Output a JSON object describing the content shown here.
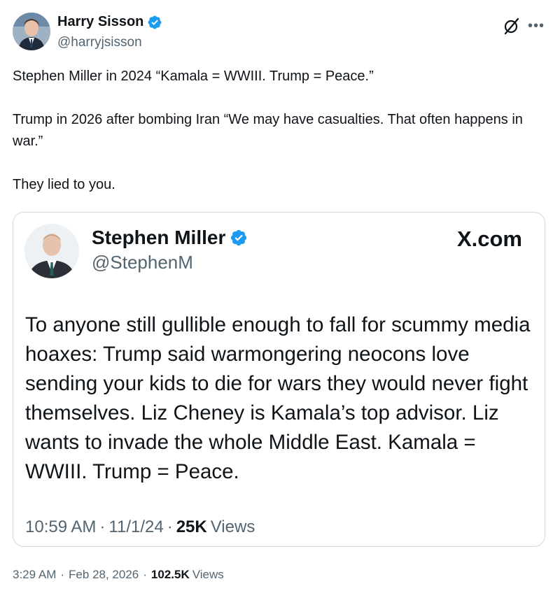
{
  "author": {
    "name": "Harry Sisson",
    "handle": "@harryjsisson",
    "verified_color": "#1d9bf0"
  },
  "tweet": {
    "lines": [
      "Stephen Miller in 2024 “Kamala = WWIII. Trump = Peace.”",
      "Trump in 2026 after bombing Iran “We may have casualties. That often happens in war.”",
      "They lied to you."
    ],
    "time": "3:29 AM",
    "date": "Feb 28, 2026",
    "views_count": "102.5K",
    "views_label": "Views"
  },
  "quoted": {
    "name": "Stephen Miller",
    "handle": "@StephenM",
    "site": "X.com",
    "text": "To anyone still gullible enough to fall for scummy media hoaxes: Trump said warmongering neocons love sending your kids to die for wars they would never fight themselves. Liz Cheney is Kamala’s top advisor. Liz wants to invade the whole Middle East. Kamala = WWIII. Trump = Peace.",
    "time": "10:59 AM",
    "date": "11/1/24",
    "views_count": "25K",
    "views_label": "Views"
  },
  "icons": {
    "grok": "grok-icon",
    "more": "more-options-icon",
    "verified": "verified-badge-icon"
  }
}
